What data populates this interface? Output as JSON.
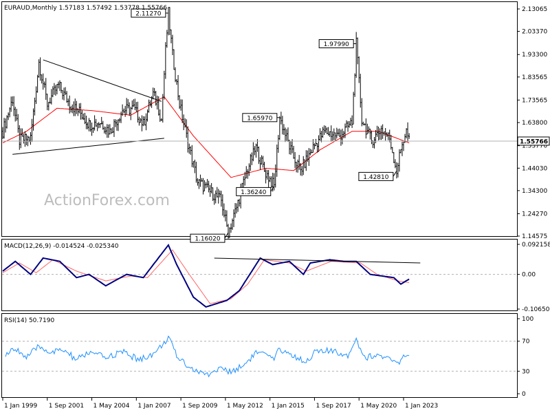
{
  "colors": {
    "background": "#ffffff",
    "axis": "#000000",
    "price_bars": "#000000",
    "moving_average": "#ff0000",
    "macd_line": "#000080",
    "signal_line": "#ff6666",
    "rsi_line": "#1e90ff",
    "trendline": "#000000",
    "grid_dashed": "#b0b0b0",
    "watermark": "#bdbdbd"
  },
  "chart_data": [
    {
      "type": "ohlc",
      "title": "EURAUD,Monthly  1.57183 1.57492 1.53778 1.55766",
      "watermark": "ActionForex.com",
      "x_axis": {
        "tick_labels": [
          "1 Jan 1999",
          "1 Sep 2001",
          "1 May 2004",
          "1 Jan 2007",
          "1 Sep 2009",
          "1 May 2012",
          "1 Jan 2015",
          "1 Sep 2017",
          "1 May 2020",
          "1 Jan 2023"
        ],
        "tick_dates": [
          "1999-01",
          "2001-09",
          "2004-05",
          "2007-01",
          "2009-09",
          "2012-05",
          "2015-01",
          "2017-09",
          "2020-05",
          "2023-01"
        ]
      },
      "y_axis": {
        "range": [
          1.14575,
          2.13065
        ],
        "tick_labels": [
          "2.13065",
          "2.03370",
          "1.93300",
          "1.83565",
          "1.73565",
          "1.63800",
          "1.53770",
          "1.44030",
          "1.34300",
          "1.24270",
          "1.14575"
        ],
        "tick_values": [
          2.13065,
          2.0337,
          1.933,
          1.83565,
          1.73565,
          1.638,
          1.5377,
          1.4403,
          1.343,
          1.2427,
          1.14575
        ]
      },
      "current_price": {
        "label": "1.55766",
        "value": 1.55766
      },
      "price_anchors": [
        {
          "date": "1999-01",
          "value": 1.6
        },
        {
          "date": "1999-08",
          "value": 1.74
        },
        {
          "date": "2000-01",
          "value": 1.56
        },
        {
          "date": "2000-09",
          "value": 1.57
        },
        {
          "date": "2001-03",
          "value": 1.9
        },
        {
          "date": "2001-09",
          "value": 1.72
        },
        {
          "date": "2002-05",
          "value": 1.8
        },
        {
          "date": "2003-01",
          "value": 1.72
        },
        {
          "date": "2003-09",
          "value": 1.68
        },
        {
          "date": "2004-03",
          "value": 1.63
        },
        {
          "date": "2004-11",
          "value": 1.64
        },
        {
          "date": "2005-06",
          "value": 1.6
        },
        {
          "date": "2006-03",
          "value": 1.69
        },
        {
          "date": "2006-11",
          "value": 1.7
        },
        {
          "date": "2007-06",
          "value": 1.63
        },
        {
          "date": "2008-01",
          "value": 1.76
        },
        {
          "date": "2008-04",
          "value": 1.72
        },
        {
          "date": "2008-07",
          "value": 1.65
        },
        {
          "date": "2008-10",
          "value": 1.95
        },
        {
          "date": "2008-12",
          "value": 2.1127
        },
        {
          "date": "2009-03",
          "value": 1.93
        },
        {
          "date": "2009-08",
          "value": 1.72
        },
        {
          "date": "2010-02",
          "value": 1.55
        },
        {
          "date": "2010-09",
          "value": 1.38
        },
        {
          "date": "2011-06",
          "value": 1.34
        },
        {
          "date": "2012-02",
          "value": 1.3
        },
        {
          "date": "2012-07",
          "value": 1.1602
        },
        {
          "date": "2013-01",
          "value": 1.27
        },
        {
          "date": "2013-09",
          "value": 1.44
        },
        {
          "date": "2014-03",
          "value": 1.53
        },
        {
          "date": "2014-09",
          "value": 1.43
        },
        {
          "date": "2015-04",
          "value": 1.3624
        },
        {
          "date": "2015-08",
          "value": 1.6597
        },
        {
          "date": "2016-05",
          "value": 1.5
        },
        {
          "date": "2016-11",
          "value": 1.43
        },
        {
          "date": "2017-08",
          "value": 1.53
        },
        {
          "date": "2018-04",
          "value": 1.6
        },
        {
          "date": "2019-03",
          "value": 1.58
        },
        {
          "date": "2019-12",
          "value": 1.64
        },
        {
          "date": "2020-03",
          "value": 1.979
        },
        {
          "date": "2020-07",
          "value": 1.65
        },
        {
          "date": "2021-02",
          "value": 1.56
        },
        {
          "date": "2021-09",
          "value": 1.61
        },
        {
          "date": "2022-03",
          "value": 1.57
        },
        {
          "date": "2022-08",
          "value": 1.4281
        },
        {
          "date": "2022-12",
          "value": 1.55
        },
        {
          "date": "2023-03",
          "value": 1.6
        },
        {
          "date": "2023-05",
          "value": 1.55766
        }
      ],
      "moving_average_anchors": [
        {
          "date": "1999-01",
          "value": 1.55
        },
        {
          "date": "2000-06",
          "value": 1.6
        },
        {
          "date": "2002-04",
          "value": 1.7
        },
        {
          "date": "2004-05",
          "value": 1.69
        },
        {
          "date": "2006-09",
          "value": 1.67
        },
        {
          "date": "2008-09",
          "value": 1.75
        },
        {
          "date": "2010-06",
          "value": 1.58
        },
        {
          "date": "2012-09",
          "value": 1.4
        },
        {
          "date": "2014-10",
          "value": 1.44
        },
        {
          "date": "2016-06",
          "value": 1.43
        },
        {
          "date": "2018-01",
          "value": 1.52
        },
        {
          "date": "2019-12",
          "value": 1.6
        },
        {
          "date": "2021-07",
          "value": 1.6
        },
        {
          "date": "2023-05",
          "value": 1.55
        }
      ],
      "annotations": [
        {
          "text": "2.11270",
          "date": "2008-12",
          "value": 2.1127
        },
        {
          "text": "1.97990",
          "date": "2020-03",
          "value": 1.9799
        },
        {
          "text": "1.65970",
          "date": "2015-08",
          "value": 1.6597
        },
        {
          "text": "1.36240",
          "date": "2015-04",
          "value": 1.3624
        },
        {
          "text": "1.16020",
          "date": "2012-07",
          "value": 1.1602
        },
        {
          "text": "1.42810",
          "date": "2022-08",
          "value": 1.4281
        }
      ],
      "trendlines": [
        {
          "from": {
            "date": "2001-06",
            "value": 1.91
          },
          "to": {
            "date": "2008-07",
            "value": 1.73
          }
        },
        {
          "from": {
            "date": "1999-08",
            "value": 1.5
          },
          "to": {
            "date": "2008-09",
            "value": 1.57
          }
        }
      ]
    },
    {
      "type": "line",
      "title": "MACD(12,26,9) -0.014524 -0.025340",
      "y_axis": {
        "range": [
          -0.106503,
          0.092158
        ],
        "tick_labels": [
          "0.092158",
          "0.00",
          "-0.106503"
        ],
        "tick_values": [
          0.092158,
          0.0,
          -0.106503
        ]
      },
      "series": [
        {
          "role": "macd",
          "anchors": [
            {
              "date": "1999-01",
              "value": 0.01
            },
            {
              "date": "1999-10",
              "value": 0.04
            },
            {
              "date": "2000-09",
              "value": 0.0
            },
            {
              "date": "2001-06",
              "value": 0.05
            },
            {
              "date": "2002-06",
              "value": 0.04
            },
            {
              "date": "2003-06",
              "value": -0.01
            },
            {
              "date": "2004-03",
              "value": 0.0
            },
            {
              "date": "2005-03",
              "value": -0.035
            },
            {
              "date": "2006-06",
              "value": 0.0
            },
            {
              "date": "2007-06",
              "value": -0.01
            },
            {
              "date": "2008-12",
              "value": 0.09
            },
            {
              "date": "2009-06",
              "value": 0.03
            },
            {
              "date": "2010-06",
              "value": -0.07
            },
            {
              "date": "2011-03",
              "value": -0.1
            },
            {
              "date": "2012-06",
              "value": -0.08
            },
            {
              "date": "2013-03",
              "value": -0.05
            },
            {
              "date": "2014-06",
              "value": 0.05
            },
            {
              "date": "2015-03",
              "value": 0.03
            },
            {
              "date": "2016-03",
              "value": 0.04
            },
            {
              "date": "2017-01",
              "value": 0.0
            },
            {
              "date": "2017-06",
              "value": 0.035
            },
            {
              "date": "2018-08",
              "value": 0.045
            },
            {
              "date": "2019-06",
              "value": 0.04
            },
            {
              "date": "2020-03",
              "value": 0.04
            },
            {
              "date": "2021-01",
              "value": 0.0
            },
            {
              "date": "2022-06",
              "value": -0.01
            },
            {
              "date": "2022-11",
              "value": -0.03
            },
            {
              "date": "2023-05",
              "value": -0.014524
            }
          ]
        },
        {
          "role": "signal",
          "anchors": [
            {
              "date": "1999-01",
              "value": 0.005
            },
            {
              "date": "2000-01",
              "value": 0.035
            },
            {
              "date": "2001-01",
              "value": 0.005
            },
            {
              "date": "2002-01",
              "value": 0.045
            },
            {
              "date": "2003-06",
              "value": 0.01
            },
            {
              "date": "2005-03",
              "value": -0.02
            },
            {
              "date": "2006-09",
              "value": -0.005
            },
            {
              "date": "2007-09",
              "value": -0.01
            },
            {
              "date": "2009-03",
              "value": 0.075
            },
            {
              "date": "2010-03",
              "value": 0.0
            },
            {
              "date": "2011-06",
              "value": -0.09
            },
            {
              "date": "2012-09",
              "value": -0.075
            },
            {
              "date": "2013-09",
              "value": -0.03
            },
            {
              "date": "2014-09",
              "value": 0.045
            },
            {
              "date": "2016-03",
              "value": 0.035
            },
            {
              "date": "2017-03",
              "value": 0.01
            },
            {
              "date": "2018-09",
              "value": 0.04
            },
            {
              "date": "2020-06",
              "value": 0.035
            },
            {
              "date": "2021-06",
              "value": 0.0
            },
            {
              "date": "2022-09",
              "value": -0.02
            },
            {
              "date": "2023-05",
              "value": -0.02534
            }
          ]
        }
      ],
      "trendline": {
        "from": {
          "date": "2011-09",
          "value": 0.05
        },
        "to": {
          "date": "2024-01",
          "value": 0.035
        }
      }
    },
    {
      "type": "line",
      "title": "RSI(14) 50.7190",
      "y_axis": {
        "range": [
          0,
          100
        ],
        "tick_labels": [
          "100",
          "70",
          "30",
          "0"
        ],
        "tick_values": [
          100,
          70,
          30,
          0
        ]
      },
      "guide_levels": [
        70,
        30
      ],
      "series": [
        {
          "role": "rsi",
          "anchors": [
            {
              "date": "1999-03",
              "value": 52
            },
            {
              "date": "1999-11",
              "value": 60
            },
            {
              "date": "2000-06",
              "value": 48
            },
            {
              "date": "2001-03",
              "value": 63
            },
            {
              "date": "2001-12",
              "value": 55
            },
            {
              "date": "2002-09",
              "value": 58
            },
            {
              "date": "2003-06",
              "value": 45
            },
            {
              "date": "2004-03",
              "value": 55
            },
            {
              "date": "2005-03",
              "value": 48
            },
            {
              "date": "2006-03",
              "value": 56
            },
            {
              "date": "2007-03",
              "value": 45
            },
            {
              "date": "2008-03",
              "value": 55
            },
            {
              "date": "2008-12",
              "value": 75
            },
            {
              "date": "2009-06",
              "value": 50
            },
            {
              "date": "2010-06",
              "value": 32
            },
            {
              "date": "2011-03",
              "value": 25
            },
            {
              "date": "2012-03",
              "value": 35
            },
            {
              "date": "2012-07",
              "value": 28
            },
            {
              "date": "2013-06",
              "value": 38
            },
            {
              "date": "2014-03",
              "value": 55
            },
            {
              "date": "2014-09",
              "value": 52
            },
            {
              "date": "2015-04",
              "value": 45
            },
            {
              "date": "2015-08",
              "value": 60
            },
            {
              "date": "2016-06",
              "value": 50
            },
            {
              "date": "2017-03",
              "value": 43
            },
            {
              "date": "2017-09",
              "value": 55
            },
            {
              "date": "2018-06",
              "value": 57
            },
            {
              "date": "2019-09",
              "value": 52
            },
            {
              "date": "2020-03",
              "value": 73
            },
            {
              "date": "2020-09",
              "value": 48
            },
            {
              "date": "2021-06",
              "value": 52
            },
            {
              "date": "2022-03",
              "value": 45
            },
            {
              "date": "2022-08",
              "value": 40
            },
            {
              "date": "2023-01",
              "value": 48
            },
            {
              "date": "2023-05",
              "value": 50.719
            }
          ]
        }
      ]
    }
  ]
}
